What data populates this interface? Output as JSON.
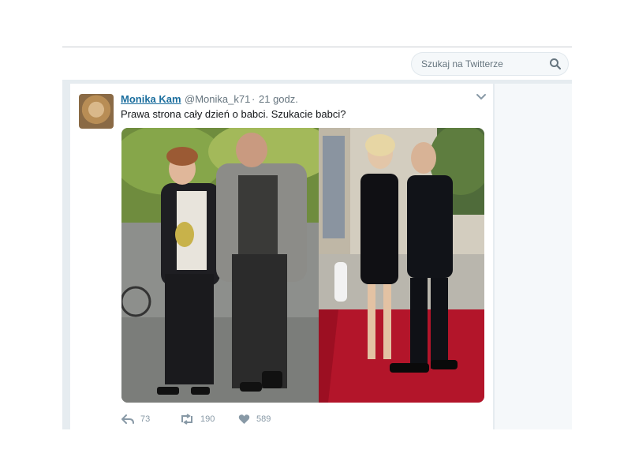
{
  "header": {
    "search_placeholder": "Szukaj na Twitterze"
  },
  "tweet": {
    "author_name": "Monika Kam",
    "author_handle": "@Monika_k71",
    "separator": "·",
    "time": "21 godz.",
    "text": "Prawa strona cały dzień o babci. Szukacie babci?",
    "stats": {
      "replies": "73",
      "retweets": "190",
      "likes": "589"
    }
  },
  "colors": {
    "link": "#1b6e9e",
    "muted": "#66757f",
    "icon": "#8899a6",
    "carpet": "#b3152a"
  },
  "icons": [
    "search-icon",
    "chevron-down-icon",
    "reply-icon",
    "retweet-icon",
    "heart-icon"
  ]
}
